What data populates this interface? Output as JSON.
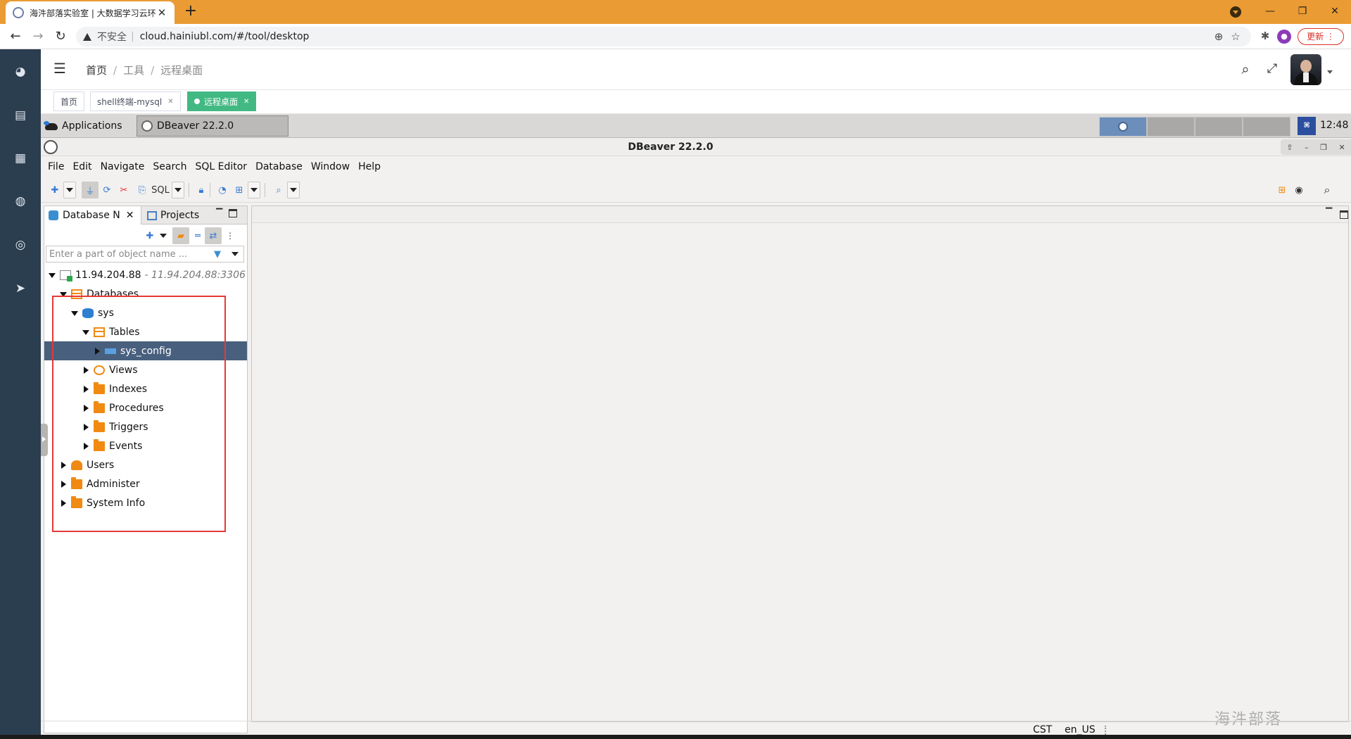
{
  "browser": {
    "tab_title": "海汼部落实验室 | 大数据学习云环",
    "url": "cloud.hainiubl.com/#/tool/desktop",
    "security_label": "不安全",
    "update_label": "更新",
    "icons": [
      "back-icon",
      "forward-icon",
      "reload-icon",
      "zoom-icon",
      "star-icon",
      "extensions-icon",
      "profile-icon",
      "more-icon"
    ]
  },
  "app": {
    "breadcrumbs": [
      "首页",
      "工具",
      "远程桌面"
    ],
    "tags": [
      {
        "label": "首页",
        "active": false
      },
      {
        "label": "shell终端-mysql",
        "active": false
      },
      {
        "label": "远程桌面",
        "active": true
      }
    ],
    "nav_icons": [
      "dashboard-icon",
      "document-icon",
      "apps-icon",
      "globe-icon",
      "lifebuoy-icon",
      "send-icon"
    ]
  },
  "desktop": {
    "applications_label": "Applications",
    "taskbar_window": "DBeaver 22.2.0",
    "clock": "12:48"
  },
  "dbeaver": {
    "title": "DBeaver 22.2.0",
    "menu": [
      "File",
      "Edit",
      "Navigate",
      "Search",
      "SQL Editor",
      "Database",
      "Window",
      "Help"
    ],
    "toolbar_sql_label": "SQL",
    "navigator_tab": "Database N",
    "projects_tab": "Projects",
    "filter_placeholder": "Enter a part of object name ...",
    "tree": {
      "connection": {
        "name": "11.94.204.88",
        "detail": "- 11.94.204.88:3306"
      },
      "databases": "Databases",
      "schema": "sys",
      "tables": "Tables",
      "selected_table": "sys_config",
      "children": [
        "Views",
        "Indexes",
        "Procedures",
        "Triggers",
        "Events"
      ],
      "root_items": [
        "Users",
        "Administer",
        "System Info"
      ]
    },
    "status": {
      "timezone": "CST",
      "locale": "en_US"
    },
    "watermark": "海汼部落"
  },
  "colors": {
    "chrome_orange": "#ea9b33",
    "sidebar": "#2b3e50",
    "active_tag": "#42b983",
    "tree_selection": "#48607e",
    "highlight_box": "#e53935"
  }
}
